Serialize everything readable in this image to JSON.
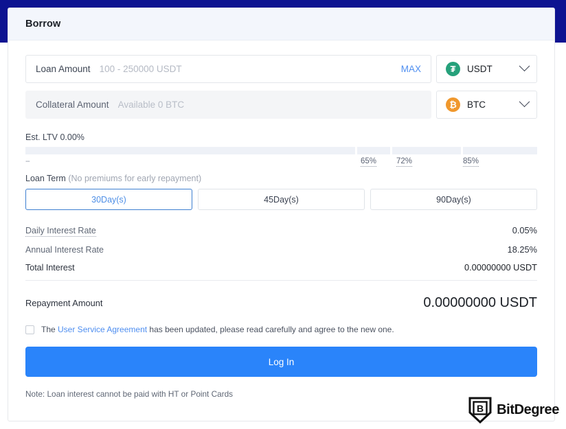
{
  "theme": {
    "navy": "#0d1391",
    "accent_blue": "#2a84fa",
    "link_blue": "#4e8ef0",
    "usdt_green": "#26a17b",
    "btc_orange": "#f0982d",
    "header_bg": "#f3f6fc"
  },
  "card": {
    "title": "Borrow"
  },
  "loan_amount": {
    "label": "Loan Amount",
    "value": "",
    "placeholder": "100 - 250000 USDT",
    "max_label": "MAX",
    "coin": {
      "symbol": "USDT",
      "glyph": "₮",
      "icon": "usdt-coin-icon"
    }
  },
  "collateral_amount": {
    "label": "Collateral Amount",
    "value": "",
    "placeholder": "Available 0 BTC",
    "coin": {
      "symbol": "BTC",
      "glyph": "₿",
      "icon": "btc-coin-icon"
    }
  },
  "ltv": {
    "label": "Est. LTV 0.00%",
    "zero_marker": "--",
    "ticks": [
      "65%",
      "72%",
      "85%"
    ]
  },
  "loan_term": {
    "label": "Loan Term",
    "note": "(No premiums for early repayment)",
    "options": [
      "30Day(s)",
      "45Day(s)",
      "90Day(s)"
    ],
    "selected": "30Day(s)"
  },
  "rates": [
    {
      "name": "Daily Interest Rate",
      "value": "0.05%"
    },
    {
      "name": "Annual Interest Rate",
      "value": "18.25%"
    },
    {
      "name": "Total Interest",
      "value": "0.00000000 USDT"
    }
  ],
  "repayment": {
    "label": "Repayment Amount",
    "value": "0.00000000 USDT"
  },
  "agreement": {
    "checked": false,
    "prefix": "The ",
    "link": "User Service Agreement",
    "suffix": " has been updated, please read carefully and agree to the new one."
  },
  "submit": {
    "label": "Log In"
  },
  "note": "Note: Loan interest cannot be paid with HT or Point Cards",
  "watermark": {
    "text": "BitDegree",
    "mark": "B"
  }
}
